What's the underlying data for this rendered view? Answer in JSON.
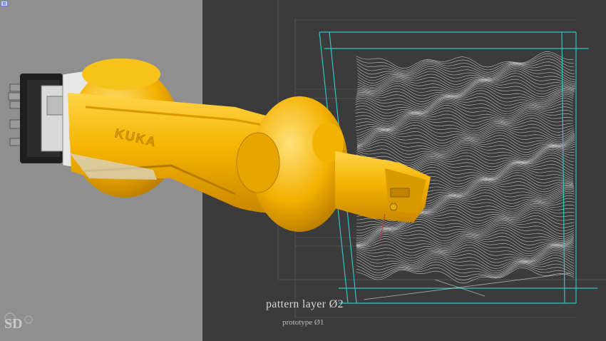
{
  "captions": {
    "title": "pattern layer Ø2",
    "subtitle": "prototype Ø1"
  },
  "robot": {
    "brand": "KUKA",
    "color": "#f5b400"
  },
  "watermark": {
    "text": "SD"
  },
  "colors": {
    "left_background": "#8f8f8f",
    "right_background": "#3b3b3b",
    "boundary_lines": "#2ec4c4",
    "pattern_lines": "#d8d8d8"
  },
  "icons": {
    "corner": "viewport-icon"
  }
}
